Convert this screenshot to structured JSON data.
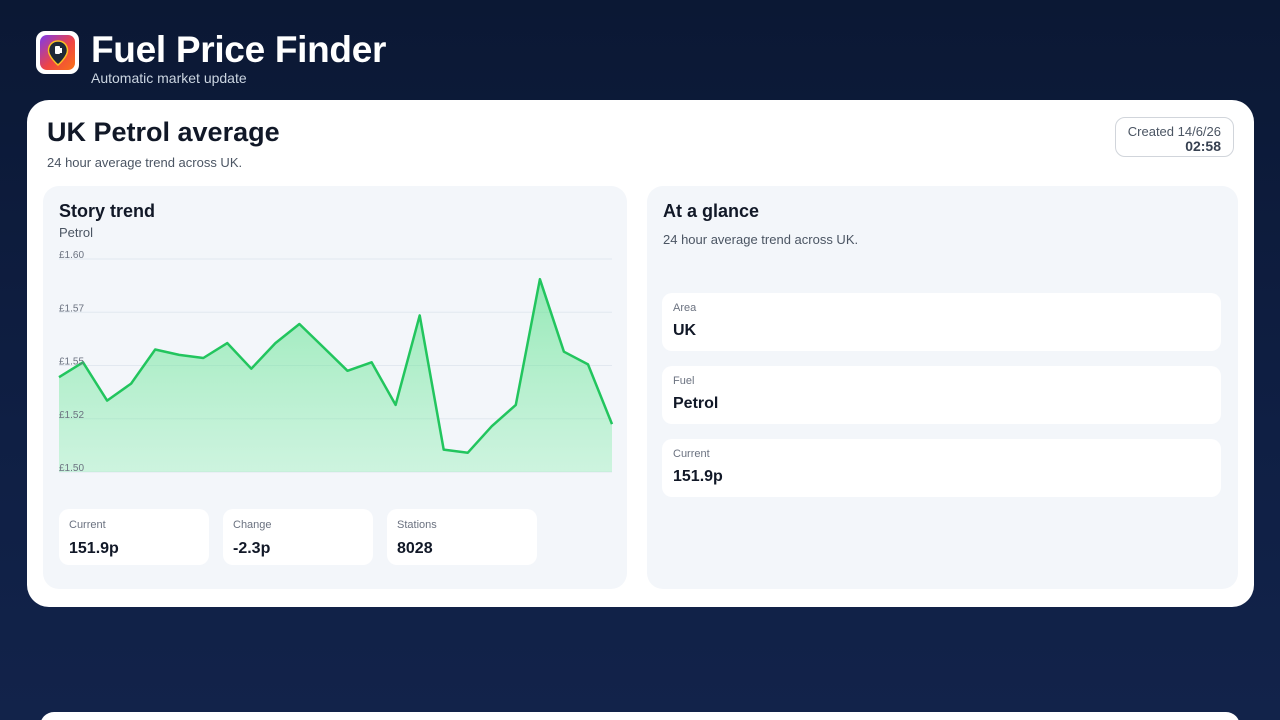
{
  "app": {
    "title": "Fuel Price Finder",
    "subtitle": "Automatic market update",
    "logo_icon": "fuel-pin-icon"
  },
  "card": {
    "title": "UK Petrol average",
    "subtitle": "24 hour average trend across UK.",
    "created_label": "Created 14/6/26",
    "created_time": "02:58"
  },
  "trend_panel": {
    "title": "Story trend",
    "subtitle": "Petrol"
  },
  "stats": [
    {
      "label": "Current",
      "value": "151.9p"
    },
    {
      "label": "Change",
      "value": "-2.3p"
    },
    {
      "label": "Stations",
      "value": "8028"
    }
  ],
  "glance_panel": {
    "title": "At a glance",
    "subtitle": "24 hour average trend across UK.",
    "rows": [
      {
        "label": "Area",
        "value": "UK"
      },
      {
        "label": "Fuel",
        "value": "Petrol"
      },
      {
        "label": "Current",
        "value": "151.9p"
      }
    ]
  },
  "colors": {
    "line": "#22c55e",
    "fill": "#86efac",
    "background": "#0f1f44"
  },
  "chart_data": {
    "type": "area",
    "title": "",
    "xlabel": "",
    "ylabel": "",
    "ylim": [
      1.5,
      1.6
    ],
    "ytick_labels": [
      "£1.60",
      "£1.57",
      "£1.55",
      "£1.52",
      "£1.50"
    ],
    "ytick_values": [
      1.6,
      1.575,
      1.55,
      1.525,
      1.5
    ],
    "grid": true,
    "series": [
      {
        "values": [
          1.5445,
          1.5515,
          1.5335,
          1.5415,
          1.5575,
          1.555,
          1.5535,
          1.5605,
          1.5485,
          1.5605,
          1.5695,
          1.5585,
          1.5475,
          1.5515,
          1.5315,
          1.5735,
          1.5105,
          1.509,
          1.5215,
          1.5315,
          1.5905,
          1.5565,
          1.5505,
          1.5225
        ]
      }
    ]
  }
}
